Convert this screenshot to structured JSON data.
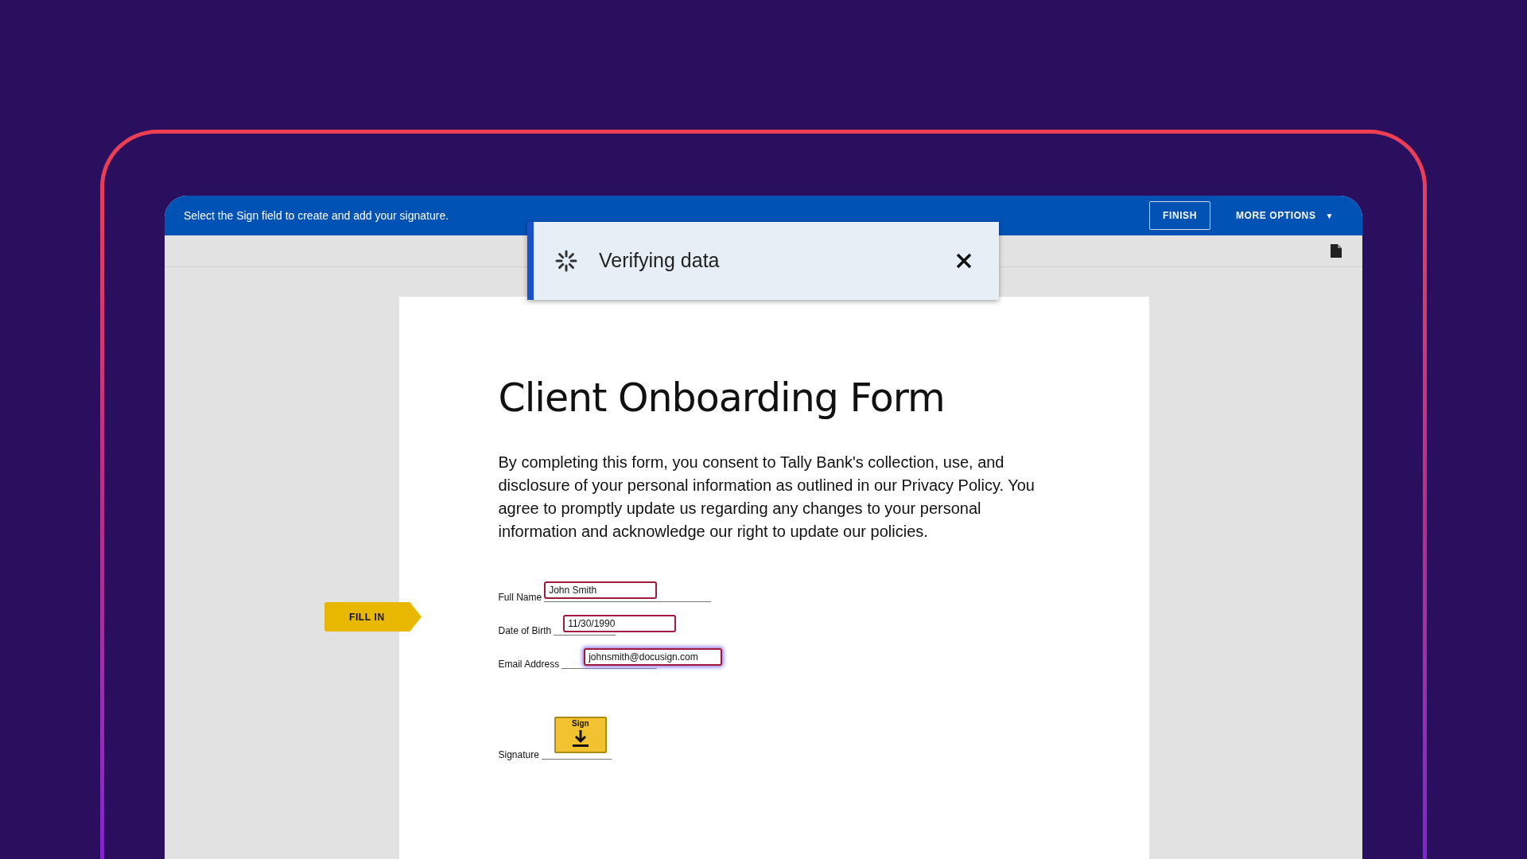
{
  "top_bar": {
    "instruction": "Select the Sign field to create and add your signature.",
    "finish_button": "FINISH",
    "more_options": "MORE OPTIONS",
    "more_options_caret": "▼"
  },
  "toast": {
    "message": "Verifying data"
  },
  "document": {
    "title": "Client Onboarding Form",
    "paragraph": "By completing this form, you consent to Tally Bank's collection, use, and disclosure of your personal information as outlined in our Privacy Policy. You agree to promptly update us regarding any changes to your personal information and acknowledge our right to update our policies.",
    "fields": [
      {
        "label": "Full Name",
        "value": "John Smith",
        "focused": false
      },
      {
        "label": "Date of Birth",
        "value": "11/30/1990",
        "focused": false
      },
      {
        "label": "Email Address",
        "value": "johnsmith@docusign.com",
        "focused": true
      }
    ],
    "signature": {
      "label": "Signature",
      "button": "Sign"
    }
  },
  "fill_in_tag": "FILL IN"
}
